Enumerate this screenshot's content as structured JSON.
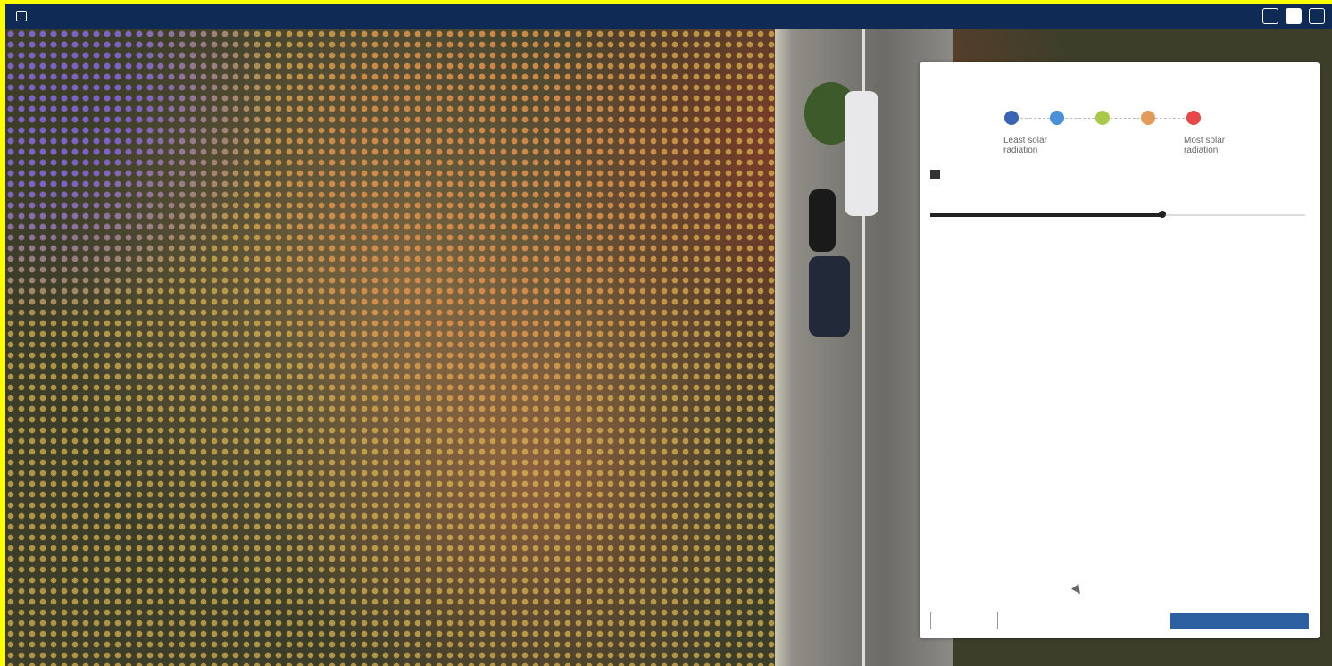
{
  "app": {
    "title": "",
    "top_buttons": [
      "",
      "",
      ""
    ]
  },
  "panel": {
    "title": "",
    "description": "",
    "legend": {
      "colors": [
        "#3a63b4",
        "#4a90d9",
        "#a9c94a",
        "#e39b5a",
        "#e8474a"
      ],
      "min_label": "Least solar radiation",
      "max_label": "Most solar radiation"
    },
    "checkbox_label": "",
    "slider_label": "",
    "slider_value_text": "",
    "slider_fraction": 0.62,
    "back_label": "",
    "next_label": ""
  }
}
